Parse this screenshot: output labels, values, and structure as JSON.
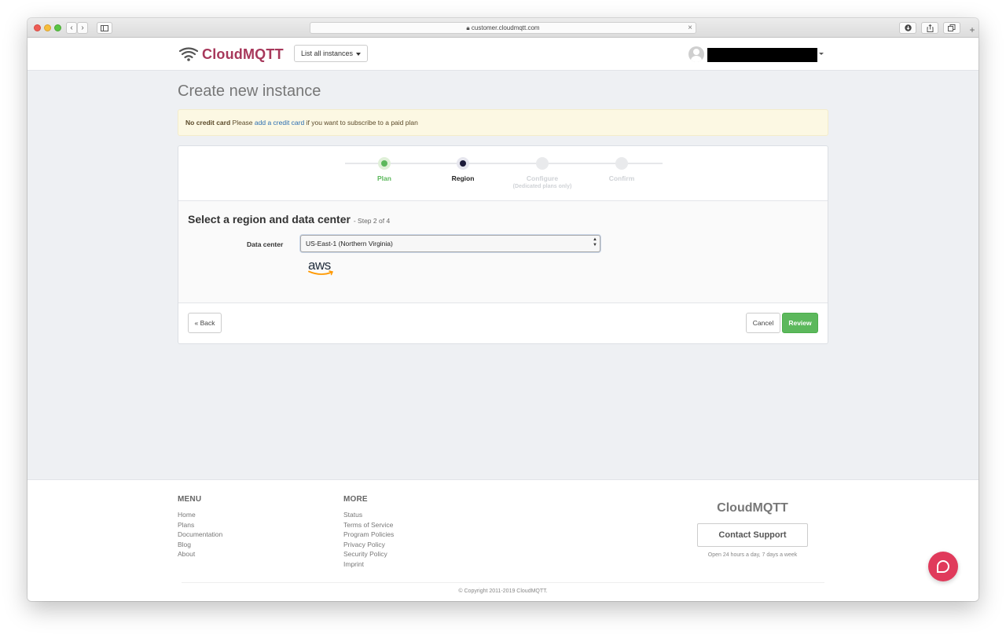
{
  "browser": {
    "url": "customer.cloudmqtt.com",
    "back_icon": "‹",
    "forward_icon": "›",
    "plus_icon": "+"
  },
  "header": {
    "logo_text": "CloudMQTT",
    "instances_dropdown": "List all instances"
  },
  "page": {
    "title": "Create new instance",
    "alert": {
      "strong": "No credit card",
      "pre": "Please",
      "link": "add a credit card",
      "post": "if you want to subscribe to a paid plan"
    }
  },
  "wizard": {
    "steps": [
      {
        "label": "Plan",
        "state": "done"
      },
      {
        "label": "Region",
        "state": "active"
      },
      {
        "label": "Configure",
        "sub": "(Dedicated plans only)",
        "state": "pending"
      },
      {
        "label": "Confirm",
        "state": "pending"
      }
    ],
    "section_title": "Select a region and data center",
    "section_sub": "- Step 2 of 4",
    "data_center_label": "Data center",
    "data_center_value": "US-East-1 (Northern Virginia)",
    "provider_logo": "aws",
    "back_label": "« Back",
    "cancel_label": "Cancel",
    "review_label": "Review"
  },
  "footer": {
    "menu_heading": "MENU",
    "menu_items": [
      "Home",
      "Plans",
      "Documentation",
      "Blog",
      "About"
    ],
    "more_heading": "MORE",
    "more_items": [
      "Status",
      "Terms of Service",
      "Program Policies",
      "Privacy Policy",
      "Security Policy",
      "Imprint"
    ],
    "brand": "CloudMQTT",
    "contact_label": "Contact Support",
    "hours": "Open 24 hours a day, 7 days a week",
    "copyright": "© Copyright 2011-2019 CloudMQTT."
  },
  "colors": {
    "brand": "#a7385b",
    "success": "#5cb85c",
    "chat": "#e03a5b"
  }
}
